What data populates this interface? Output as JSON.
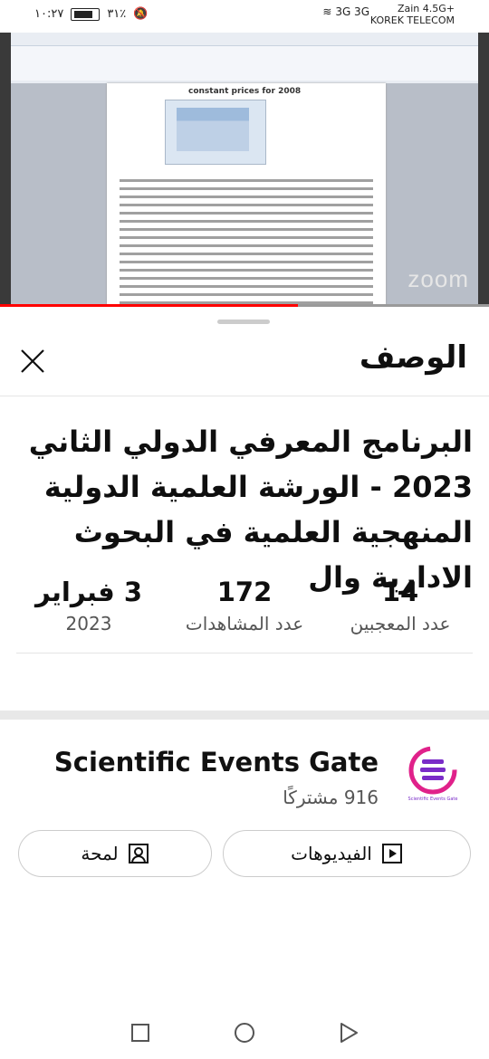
{
  "status_bar": {
    "time": "١٠:٢٧",
    "battery": "٣١٪",
    "signal": "3G 3G",
    "carrier_line1": "Zain 4.5G+",
    "carrier_line2": "KOREK TELECOM"
  },
  "video": {
    "zoom_watermark": "zoom",
    "doc_heading": "constant prices for 2008",
    "progress_fraction": 0.61
  },
  "sheet": {
    "title": "الوصف",
    "video_title": "البرنامج المعرفي الدولي الثاني 2023 - الورشة العلمية الدولية المنهجية العلمية في البحوث الادارية وال",
    "stats": [
      {
        "value": "14",
        "label": "عدد المعجبين"
      },
      {
        "value": "172",
        "label": "عدد المشاهدات"
      },
      {
        "value": "3 فبراير",
        "label": "2023"
      }
    ]
  },
  "channel": {
    "name": "Scientific Events Gate",
    "subscribers": "916 مشتركًا",
    "logo_caption": "Scientific Events Gate",
    "logo_colors": [
      "#e0218a",
      "#7a2cc8"
    ]
  },
  "buttons": {
    "videos": "الفيديوهات",
    "about": "لمحة"
  },
  "icons": {
    "close": "close-icon",
    "videos": "play-square-icon",
    "about": "person-icon",
    "nav": [
      "recents-icon",
      "home-icon",
      "back-icon"
    ]
  }
}
